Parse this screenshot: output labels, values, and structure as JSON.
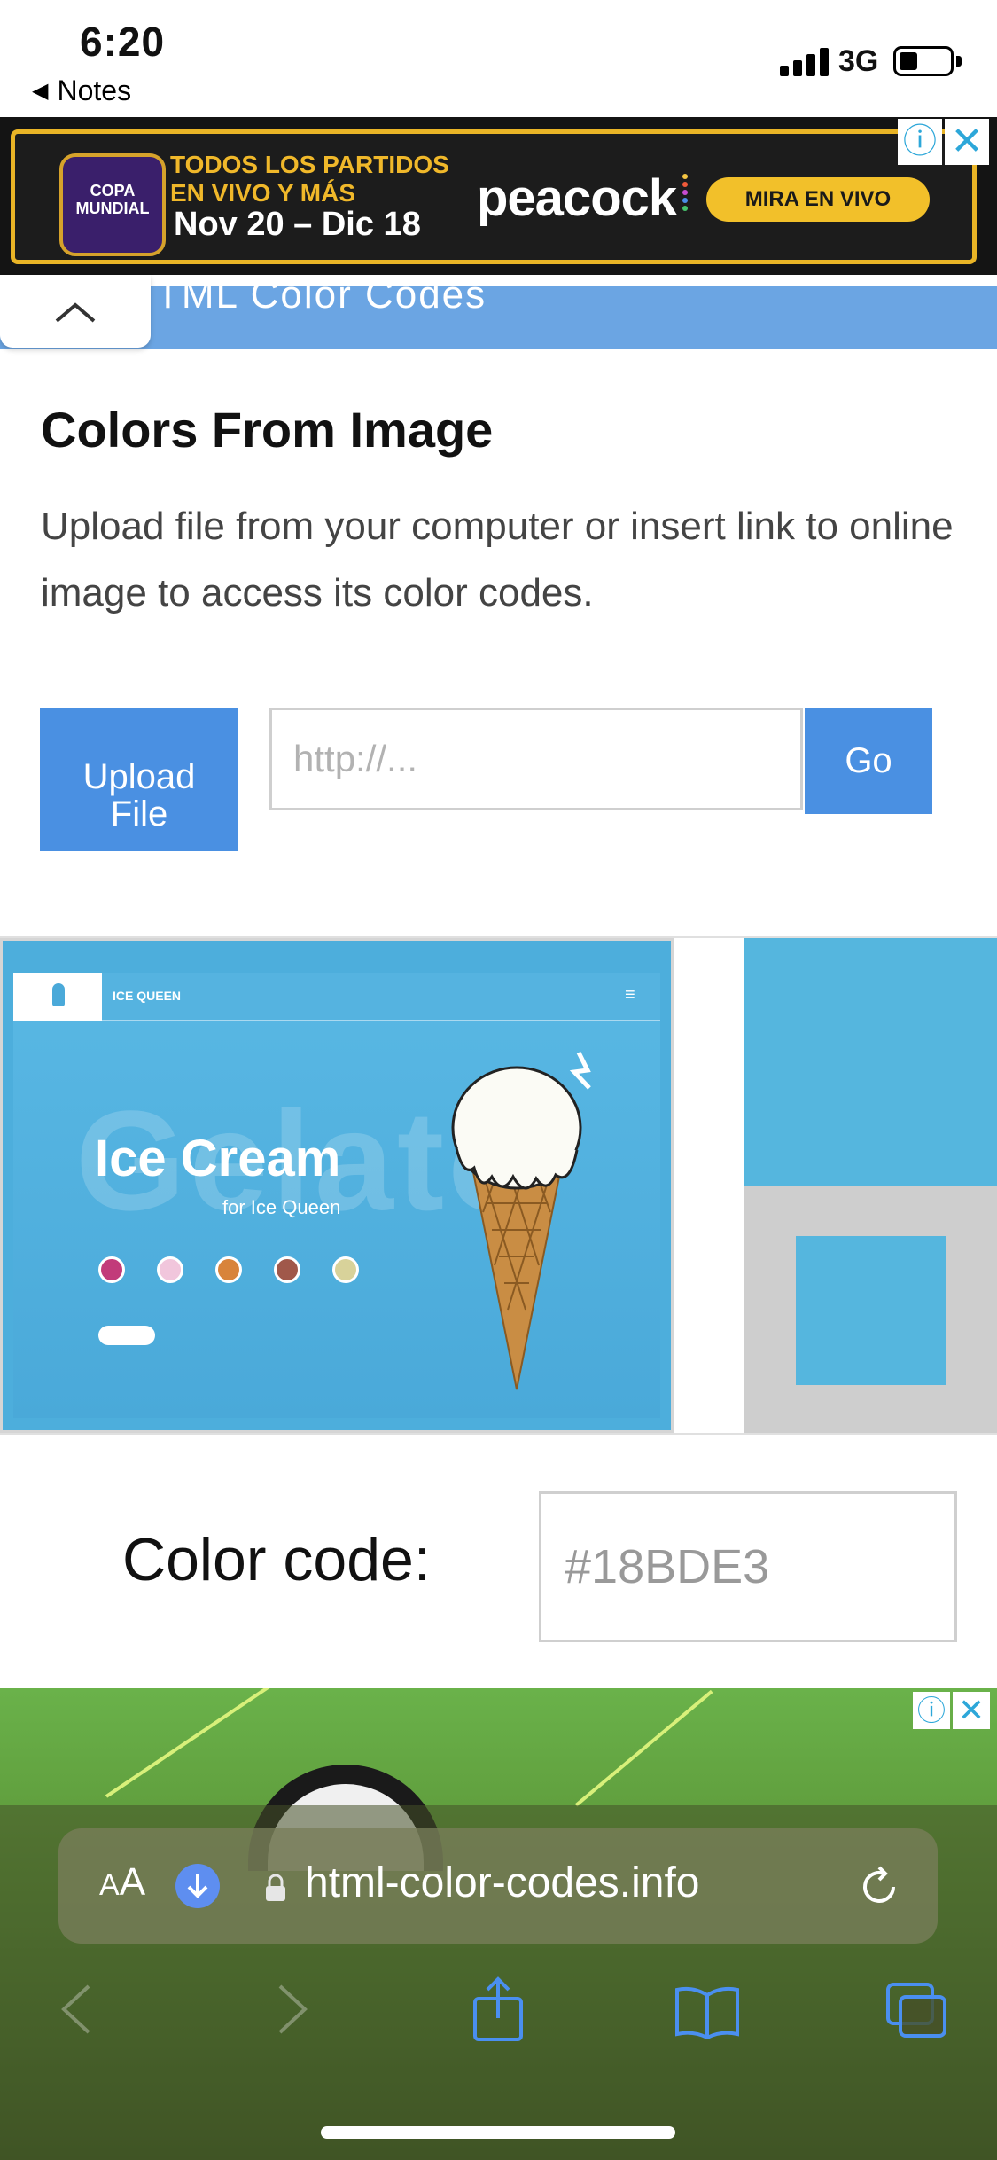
{
  "status_bar": {
    "time": "6:20",
    "back_app": "Notes",
    "network": "3G"
  },
  "ad_top": {
    "badge_text": "COPA MUNDIAL",
    "line1": "TODOS LOS PARTIDOS",
    "line2": "EN VIVO Y MÁS",
    "line3": "Nov 20 – Dic 18",
    "brand": "peacock",
    "cta": "MIRA EN VIVO",
    "info_icon": "info-icon",
    "close_icon": "close-icon"
  },
  "header": {
    "site_title": "TML Color Codes"
  },
  "content": {
    "title": "Colors From Image",
    "description": "Upload file from your computer or insert link to online image to access its color codes.",
    "upload_label": "Upload\nFile",
    "url_placeholder": "http://...",
    "go_label": "Go"
  },
  "preview_image": {
    "brand": "ICE QUEEN",
    "background_word": "Gelato",
    "heading": "Ice Cream",
    "subheading": "for Ice Queen",
    "menu_icon": "≡"
  },
  "picked_color": {
    "swatch": "#55B6DE"
  },
  "color_code": {
    "label": "Color code:",
    "value": "#18BDE3"
  },
  "safari": {
    "aa_label": "AA",
    "url": "html-color-codes.info"
  },
  "colors": {
    "accent": "#4A90E2",
    "header": "#6BA5E3",
    "ad_gold": "#F0B82A"
  }
}
